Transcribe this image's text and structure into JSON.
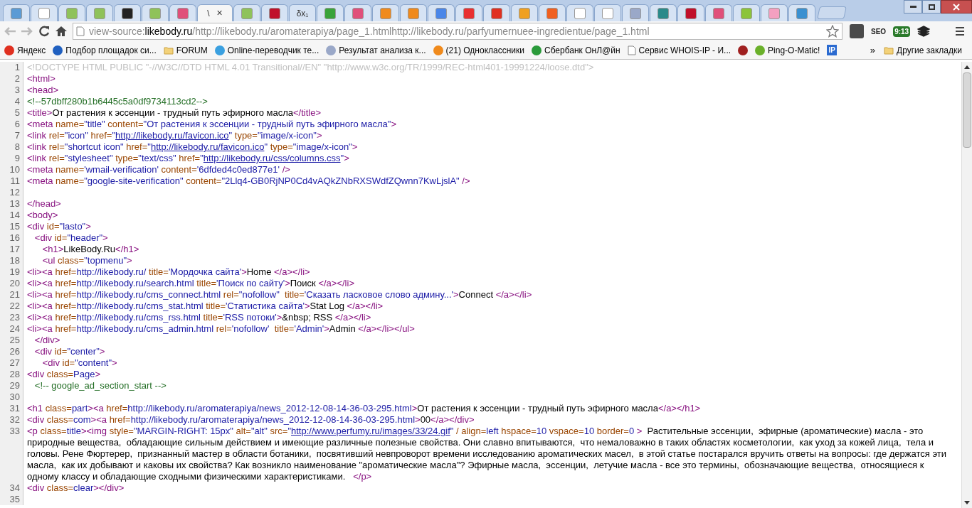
{
  "tabs": [
    {
      "selected": false,
      "color": "#5b9bd5"
    },
    {
      "selected": false,
      "color": "#ffffff"
    },
    {
      "selected": false,
      "color": "#8fc25a"
    },
    {
      "selected": false,
      "color": "#8fc25a"
    },
    {
      "selected": false,
      "color": "#222222"
    },
    {
      "selected": false,
      "color": "#8fc25a"
    },
    {
      "selected": false,
      "color": "#e0507a"
    },
    {
      "selected": true,
      "title": "\\",
      "close": "×"
    },
    {
      "selected": false,
      "color": "#8fc25a"
    },
    {
      "selected": false,
      "color": "#c0102a"
    },
    {
      "selected": false,
      "title": "δx₁"
    },
    {
      "selected": false,
      "color": "#3aa33a"
    },
    {
      "selected": false,
      "color": "#e0507a"
    },
    {
      "selected": false,
      "color": "#f08a1c"
    },
    {
      "selected": false,
      "color": "#f08a1c"
    },
    {
      "selected": false,
      "color": "#4a86e8"
    },
    {
      "selected": false,
      "color": "#e83030"
    },
    {
      "selected": false,
      "color": "#e03020"
    },
    {
      "selected": false,
      "color": "#f0a020"
    },
    {
      "selected": false,
      "color": "#f06020"
    },
    {
      "selected": false,
      "color": "#ffffff"
    },
    {
      "selected": false,
      "color": "#ffffff"
    },
    {
      "selected": false,
      "color": "#9aa8c8"
    },
    {
      "selected": false,
      "color": "#2a8a8a"
    },
    {
      "selected": false,
      "color": "#c0102a"
    },
    {
      "selected": false,
      "color": "#e0507a"
    },
    {
      "selected": false,
      "color": "#8cc43a"
    },
    {
      "selected": false,
      "color": "#f4a0c0"
    },
    {
      "selected": false,
      "color": "#3a90d0"
    }
  ],
  "address": {
    "parts": [
      {
        "kind": "scheme",
        "text": "view-source:"
      },
      {
        "kind": "host",
        "text": "likebody.ru"
      },
      {
        "kind": "path",
        "text": "/http://likebody.ru/aromaterapiya/page_1.htmlhttp://likebody.ru/parfyumernuee-ingredientue/page_1.html"
      }
    ]
  },
  "extensions": [
    {
      "kind": "z"
    },
    {
      "kind": "text",
      "text": "SEO"
    },
    {
      "kind": "clock",
      "text": "9:13"
    },
    {
      "kind": "layers"
    }
  ],
  "bookmarks": [
    {
      "kind": "site",
      "label": "Яндекс",
      "color": "#e03020"
    },
    {
      "kind": "site",
      "label": "Подбор площадок си...",
      "color": "#2060c0"
    },
    {
      "kind": "folder",
      "label": "FORUM"
    },
    {
      "kind": "site",
      "label": "Online-переводчик те...",
      "color": "#3aa0e0"
    },
    {
      "kind": "site",
      "label": "Результат анализа к...",
      "color": "#9aa8c8"
    },
    {
      "kind": "site",
      "label": "(21) Одноклассники",
      "color": "#f08a1c"
    },
    {
      "kind": "site",
      "label": "Сбербанк ОнЛ@йн",
      "color": "#2a9a3a"
    },
    {
      "kind": "page",
      "label": "Сервис WHOIS-IP - И..."
    },
    {
      "kind": "site",
      "color": "#a02020"
    },
    {
      "kind": "site",
      "label": "Ping-O-Matic!",
      "color": "#6ab02a"
    },
    {
      "kind": "badge",
      "label": "IP"
    }
  ],
  "bookmarks_more": "»",
  "other_bookmarks": "Другие закладки",
  "source_lines": [
    {
      "number": "1",
      "segments": [
        {
          "kind": "doctype",
          "text": "<!DOCTYPE HTML PUBLIC \"-//W3C//DTD HTML 4.01 Transitional//EN\" \"http://www.w3c.org/TR/1999/REC-html401-19991224/loose.dtd\">"
        }
      ]
    },
    {
      "number": "2",
      "segments": [
        {
          "kind": "tag",
          "text": "<html>"
        }
      ]
    },
    {
      "number": "3",
      "segments": [
        {
          "kind": "tag",
          "text": "<head>"
        }
      ]
    },
    {
      "number": "4",
      "segments": [
        {
          "kind": "comment",
          "text": "<!--57dbff280b1b6445c5a0df9734113cd2-->"
        }
      ]
    },
    {
      "number": "5",
      "segments": [
        {
          "kind": "tag",
          "text": "<title>"
        },
        {
          "kind": "text",
          "text": "От растения к эссенции - трудный путь эфирного масла"
        },
        {
          "kind": "tag",
          "text": "</title>"
        }
      ]
    },
    {
      "number": "6",
      "segments": [
        {
          "kind": "tag",
          "text": "<meta"
        },
        {
          "kind": "attr",
          "text": " name="
        },
        {
          "kind": "value",
          "text": "\"title\""
        },
        {
          "kind": "attr",
          "text": " content="
        },
        {
          "kind": "value",
          "text": "\"От растения к эссенции - трудный путь эфирного масла\""
        },
        {
          "kind": "tag",
          "text": ">"
        }
      ]
    },
    {
      "number": "7",
      "segments": [
        {
          "kind": "tag",
          "text": "<link"
        },
        {
          "kind": "attr",
          "text": " rel="
        },
        {
          "kind": "value",
          "text": "\"icon\""
        },
        {
          "kind": "attr",
          "text": " href="
        },
        {
          "kind": "value",
          "text": "\""
        },
        {
          "kind": "link",
          "text": "http://likebody.ru/favicon.ico"
        },
        {
          "kind": "value",
          "text": "\""
        },
        {
          "kind": "attr",
          "text": " type="
        },
        {
          "kind": "value",
          "text": "\"image/x-icon\""
        },
        {
          "kind": "tag",
          "text": ">"
        }
      ]
    },
    {
      "number": "8",
      "segments": [
        {
          "kind": "tag",
          "text": "<link"
        },
        {
          "kind": "attr",
          "text": " rel="
        },
        {
          "kind": "value",
          "text": "\"shortcut icon\""
        },
        {
          "kind": "attr",
          "text": " href="
        },
        {
          "kind": "value",
          "text": "\""
        },
        {
          "kind": "link",
          "text": "http://likebody.ru/favicon.ico"
        },
        {
          "kind": "value",
          "text": "\""
        },
        {
          "kind": "attr",
          "text": " type="
        },
        {
          "kind": "value",
          "text": "\"image/x-icon\""
        },
        {
          "kind": "tag",
          "text": ">"
        }
      ]
    },
    {
      "number": "9",
      "segments": [
        {
          "kind": "tag",
          "text": "<link"
        },
        {
          "kind": "attr",
          "text": " rel="
        },
        {
          "kind": "value",
          "text": "\"stylesheet\""
        },
        {
          "kind": "attr",
          "text": " type="
        },
        {
          "kind": "value",
          "text": "\"text/css\""
        },
        {
          "kind": "attr",
          "text": " href="
        },
        {
          "kind": "value",
          "text": "\""
        },
        {
          "kind": "link",
          "text": "http://likebody.ru/css/columns.css"
        },
        {
          "kind": "value",
          "text": "\""
        },
        {
          "kind": "tag",
          "text": ">"
        }
      ]
    },
    {
      "number": "10",
      "segments": [
        {
          "kind": "tag",
          "text": "<meta"
        },
        {
          "kind": "attr",
          "text": " name="
        },
        {
          "kind": "value",
          "text": "'wmail-verification'"
        },
        {
          "kind": "attr",
          "text": " content="
        },
        {
          "kind": "value",
          "text": "'6dfded4c0ed877e1'"
        },
        {
          "kind": "tag",
          "text": " />"
        }
      ]
    },
    {
      "number": "11",
      "segments": [
        {
          "kind": "tag",
          "text": "<meta"
        },
        {
          "kind": "attr",
          "text": " name="
        },
        {
          "kind": "value",
          "text": "\"google-site-verification\""
        },
        {
          "kind": "attr",
          "text": " content="
        },
        {
          "kind": "value",
          "text": "\"2Llq4-GB0RjNP0Cd4vAQkZNbRXSWdfZQwnn7KwLjslA\""
        },
        {
          "kind": "tag",
          "text": " />"
        }
      ]
    },
    {
      "number": "12"
    },
    {
      "number": "13",
      "segments": [
        {
          "kind": "tag",
          "text": "</head>"
        }
      ]
    },
    {
      "number": "14",
      "segments": [
        {
          "kind": "tag",
          "text": "<body>"
        }
      ]
    },
    {
      "number": "15",
      "segments": [
        {
          "kind": "tag",
          "text": "<div"
        },
        {
          "kind": "attr",
          "text": " id="
        },
        {
          "kind": "value",
          "text": "\"lasto\""
        },
        {
          "kind": "tag",
          "text": ">"
        }
      ]
    },
    {
      "number": "16",
      "segments": [
        {
          "kind": "tag",
          "text": "   <div"
        },
        {
          "kind": "attr",
          "text": " id="
        },
        {
          "kind": "value",
          "text": "\"header\""
        },
        {
          "kind": "tag",
          "text": ">"
        }
      ]
    },
    {
      "number": "17",
      "segments": [
        {
          "kind": "tag",
          "text": "      <h1>"
        },
        {
          "kind": "text",
          "text": "LikeBody.Ru"
        },
        {
          "kind": "tag",
          "text": "</h1>"
        }
      ]
    },
    {
      "number": "18",
      "segments": [
        {
          "kind": "tag",
          "text": "      <ul"
        },
        {
          "kind": "attr",
          "text": " class="
        },
        {
          "kind": "value",
          "text": "\"topmenu\""
        },
        {
          "kind": "tag",
          "text": ">"
        }
      ]
    },
    {
      "number": "19",
      "segments": [
        {
          "kind": "tag",
          "text": "<li><a"
        },
        {
          "kind": "attr",
          "text": " href="
        },
        {
          "kind": "value",
          "text": "http://likebody.ru/"
        },
        {
          "kind": "attr",
          "text": " title="
        },
        {
          "kind": "value",
          "text": "'Мордочка сайта'"
        },
        {
          "kind": "tag",
          "text": ">"
        },
        {
          "kind": "text",
          "text": "Home "
        },
        {
          "kind": "tag",
          "text": "</a></li>"
        }
      ]
    },
    {
      "number": "20",
      "segments": [
        {
          "kind": "tag",
          "text": "<li><a"
        },
        {
          "kind": "attr",
          "text": " href="
        },
        {
          "kind": "value",
          "text": "http://likebody.ru/search.html"
        },
        {
          "kind": "attr",
          "text": " title="
        },
        {
          "kind": "value",
          "text": "'Поиск по сайту'"
        },
        {
          "kind": "tag",
          "text": ">"
        },
        {
          "kind": "text",
          "text": "Поиск "
        },
        {
          "kind": "tag",
          "text": "</a></li>"
        }
      ]
    },
    {
      "number": "21",
      "segments": [
        {
          "kind": "tag",
          "text": "<li><a"
        },
        {
          "kind": "attr",
          "text": " href="
        },
        {
          "kind": "value",
          "text": "http://likebody.ru/cms_connect.html"
        },
        {
          "kind": "attr",
          "text": " rel="
        },
        {
          "kind": "value",
          "text": "\"nofollow\""
        },
        {
          "kind": "attr",
          "text": "  title="
        },
        {
          "kind": "value",
          "text": "'Сказать ласковое слово админу...'"
        },
        {
          "kind": "tag",
          "text": ">"
        },
        {
          "kind": "text",
          "text": "Connect "
        },
        {
          "kind": "tag",
          "text": "</a></li>"
        }
      ]
    },
    {
      "number": "22",
      "segments": [
        {
          "kind": "tag",
          "text": "<li><a"
        },
        {
          "kind": "attr",
          "text": " href="
        },
        {
          "kind": "value",
          "text": "http://likebody.ru/cms_stat.html"
        },
        {
          "kind": "attr",
          "text": " title="
        },
        {
          "kind": "value",
          "text": "'Статистика сайта'"
        },
        {
          "kind": "tag",
          "text": ">"
        },
        {
          "kind": "text",
          "text": "Stat Log "
        },
        {
          "kind": "tag",
          "text": "</a></li>"
        }
      ]
    },
    {
      "number": "23",
      "segments": [
        {
          "kind": "tag",
          "text": "<li><a"
        },
        {
          "kind": "attr",
          "text": " href="
        },
        {
          "kind": "value",
          "text": "http://likebody.ru/cms_rss.html"
        },
        {
          "kind": "attr",
          "text": " title="
        },
        {
          "kind": "value",
          "text": "'RSS потоки'"
        },
        {
          "kind": "tag",
          "text": ">"
        },
        {
          "kind": "text",
          "text": "&nbsp; RSS "
        },
        {
          "kind": "tag",
          "text": "</a></li>"
        }
      ]
    },
    {
      "number": "24",
      "segments": [
        {
          "kind": "tag",
          "text": "<li><a"
        },
        {
          "kind": "attr",
          "text": " href="
        },
        {
          "kind": "value",
          "text": "http://likebody.ru/cms_admin.html"
        },
        {
          "kind": "attr",
          "text": " rel="
        },
        {
          "kind": "value",
          "text": "'nofollow'"
        },
        {
          "kind": "attr",
          "text": "  title="
        },
        {
          "kind": "value",
          "text": "'Admin'"
        },
        {
          "kind": "tag",
          "text": ">"
        },
        {
          "kind": "text",
          "text": "Admin "
        },
        {
          "kind": "tag",
          "text": "</a></li></ul>"
        }
      ]
    },
    {
      "number": "25",
      "segments": [
        {
          "kind": "tag",
          "text": "   </div>"
        }
      ]
    },
    {
      "number": "26",
      "segments": [
        {
          "kind": "tag",
          "text": "   <div"
        },
        {
          "kind": "attr",
          "text": " id="
        },
        {
          "kind": "value",
          "text": "\"center\""
        },
        {
          "kind": "tag",
          "text": ">"
        }
      ]
    },
    {
      "number": "27",
      "segments": [
        {
          "kind": "tag",
          "text": "      <div"
        },
        {
          "kind": "attr",
          "text": " id="
        },
        {
          "kind": "value",
          "text": "\"content\""
        },
        {
          "kind": "tag",
          "text": ">"
        }
      ]
    },
    {
      "number": "28",
      "segments": [
        {
          "kind": "tag",
          "text": "<div"
        },
        {
          "kind": "attr",
          "text": " class="
        },
        {
          "kind": "value",
          "text": "Page"
        },
        {
          "kind": "tag",
          "text": ">"
        }
      ]
    },
    {
      "number": "29",
      "segments": [
        {
          "kind": "comment",
          "text": "   <!-- google_ad_section_start -->"
        }
      ]
    },
    {
      "number": "30"
    },
    {
      "number": "31",
      "segments": [
        {
          "kind": "tag",
          "text": "<h1"
        },
        {
          "kind": "attr",
          "text": " class="
        },
        {
          "kind": "value",
          "text": "part"
        },
        {
          "kind": "tag",
          "text": "><a"
        },
        {
          "kind": "attr",
          "text": " href="
        },
        {
          "kind": "value",
          "text": "http://likebody.ru/aromaterapiya/news_2012-12-08-14-36-03-295.html"
        },
        {
          "kind": "tag",
          "text": ">"
        },
        {
          "kind": "text",
          "text": "От растения к эссенции - трудный путь эфирного масла"
        },
        {
          "kind": "tag",
          "text": "</a></h1>"
        }
      ]
    },
    {
      "number": "32",
      "segments": [
        {
          "kind": "tag",
          "text": "<div"
        },
        {
          "kind": "attr",
          "text": " class="
        },
        {
          "kind": "value",
          "text": "com"
        },
        {
          "kind": "tag",
          "text": "><a"
        },
        {
          "kind": "attr",
          "text": " href="
        },
        {
          "kind": "value",
          "text": "http://likebody.ru/aromaterapiya/news_2012-12-08-14-36-03-295.html"
        },
        {
          "kind": "tag",
          "text": ">"
        },
        {
          "kind": "text",
          "text": "00"
        },
        {
          "kind": "tag",
          "text": "</a></div>"
        }
      ]
    },
    {
      "number": "33",
      "segments": [
        {
          "kind": "tag",
          "text": "<p"
        },
        {
          "kind": "attr",
          "text": " class="
        },
        {
          "kind": "value",
          "text": "title"
        },
        {
          "kind": "tag",
          "text": "><img"
        },
        {
          "kind": "attr",
          "text": " style="
        },
        {
          "kind": "value",
          "text": "\"MARGIN-RIGHT: 15px\""
        },
        {
          "kind": "attr",
          "text": " alt="
        },
        {
          "kind": "value",
          "text": "\"alt\""
        },
        {
          "kind": "attr",
          "text": " src="
        },
        {
          "kind": "value",
          "text": "\""
        },
        {
          "kind": "link",
          "text": "http://www.perfumy.ru/images/33/24.gif"
        },
        {
          "kind": "value",
          "text": "\""
        },
        {
          "kind": "attr",
          "text": " / align="
        },
        {
          "kind": "value",
          "text": "left"
        },
        {
          "kind": "attr",
          "text": " hspace="
        },
        {
          "kind": "value",
          "text": "10"
        },
        {
          "kind": "attr",
          "text": " vspace="
        },
        {
          "kind": "value",
          "text": "10"
        },
        {
          "kind": "attr",
          "text": " border="
        },
        {
          "kind": "value",
          "text": "0"
        },
        {
          "kind": "tag",
          "text": " >"
        },
        {
          "kind": "text",
          "text": "  Растительные эссенции,  эфирные (ароматические) масла - это природные вещества,  обладающие сильным действием и имеющие различные полезные свойства. Они славно впитываются,  что немаловажно в таких областях косметологии,  как уход за кожей лица,  тела и головы. Рене Фюртерер,  признанный мастер в области ботаники,  посвятивший невпроворот времени исследованию ароматических масел,  в этой статье постарался вручить ответы на вопросы: где держатся эти масла,  как их добывают и каковы их свойства? Как возникло наименование \"ароматические масла\"? Эфирные масла,  эссенции,  летучие масла - все это термины,  обозначающие вещества,  относящиеся к одному классу и обладающие сходными физическими характеристиками.   "
        },
        {
          "kind": "tag",
          "text": "</p>"
        }
      ]
    },
    {
      "number": "34",
      "segments": [
        {
          "kind": "tag",
          "text": "<div"
        },
        {
          "kind": "attr",
          "text": " class="
        },
        {
          "kind": "value",
          "text": "clear"
        },
        {
          "kind": "tag",
          "text": "></div>"
        }
      ]
    },
    {
      "number": "35"
    }
  ]
}
